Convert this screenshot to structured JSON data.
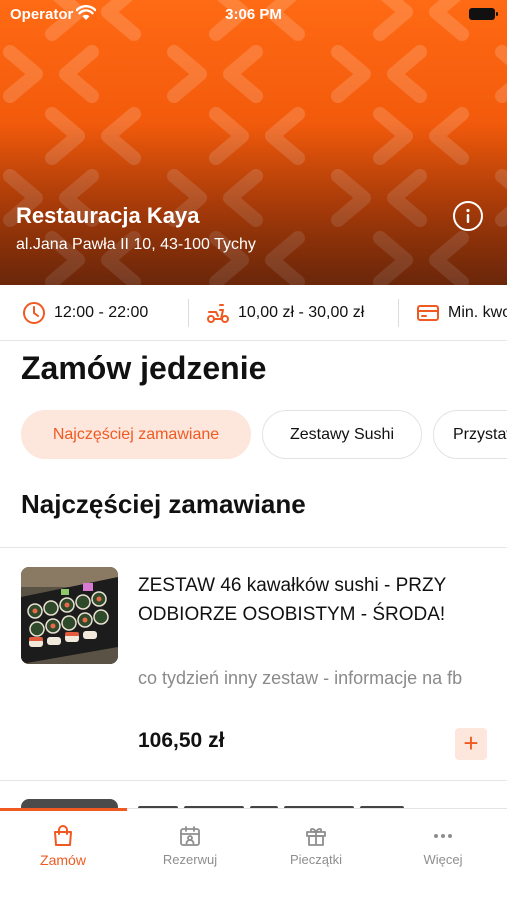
{
  "status_bar": {
    "operator": "Operator",
    "time": "3:06 PM"
  },
  "restaurant": {
    "name": "Restauracja Kaya",
    "address": "al.Jana Pawła II 10, 43-100 Tychy"
  },
  "info_strip": {
    "hours": "12:00 - 22:00",
    "delivery_cost": "10,00 zł - 30,00 zł",
    "min_order": "Min. kwota"
  },
  "main": {
    "title": "Zamów jedzenie",
    "categories": [
      {
        "label": "Najczęściej zamawiane",
        "active": true
      },
      {
        "label": "Zestawy Sushi",
        "active": false
      },
      {
        "label": "Przystawki",
        "active": false
      }
    ],
    "section_title": "Najczęściej zamawiane"
  },
  "products": [
    {
      "name": "ZESTAW 46 kawałków sushi - PRZY ODBIORZE OSOBISTYM - ŚRODA!",
      "description": "co tydzień inny zestaw - informacje na fb",
      "price": "106,50 zł",
      "add_label": "+"
    }
  ],
  "tabbar": {
    "tabs": [
      {
        "label": "Zamów",
        "icon": "shopping-bag-icon",
        "active": true
      },
      {
        "label": "Rezerwuj",
        "icon": "calendar-person-icon",
        "active": false
      },
      {
        "label": "Pieczątki",
        "icon": "gift-icon",
        "active": false
      },
      {
        "label": "Więcej",
        "icon": "more-dots-icon",
        "active": false
      }
    ]
  },
  "colors": {
    "accent": "#f05a22",
    "accent_light": "#fde6dc",
    "hero": "#f25a0b"
  }
}
